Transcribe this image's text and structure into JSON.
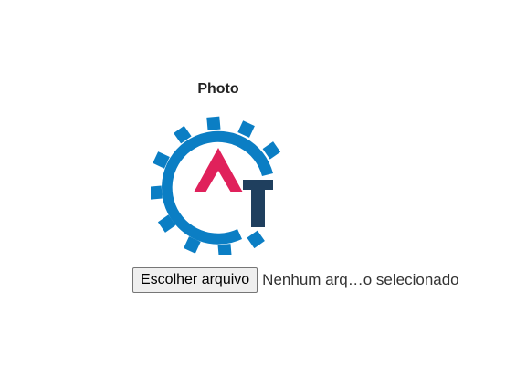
{
  "photo": {
    "label": "Photo"
  },
  "logo": {
    "icon": "at-gear-logo-icon",
    "gear_color": "#0b7ec4",
    "triangle_color": "#e0215b",
    "t_color": "#1f3f5e"
  },
  "file_input": {
    "button_label": "Escolher arquivo",
    "status_text": "Nenhum arq…o selecionado"
  }
}
